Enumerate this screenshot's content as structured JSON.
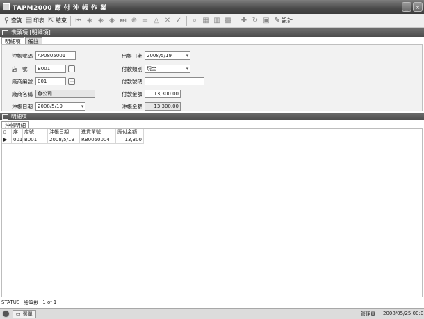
{
  "window": {
    "title": "TAPM2000 應 付 沖 帳 作 業",
    "controls": [
      "minimize",
      "close"
    ]
  },
  "toolbar": {
    "query_label": "查詢",
    "print_label": "印表",
    "exit_label": "結束",
    "design_label": "設計"
  },
  "header": {
    "title": "表頭項 [明細項]"
  },
  "form_tabs": [
    "明細項",
    "備註"
  ],
  "form": {
    "voucher_no_label": "沖帳號碼",
    "voucher_no": "AP0805001",
    "store_label": "店　號",
    "store": "B001",
    "vendor_code_label": "廠商編號",
    "vendor_code": "001",
    "vendor_name_label": "廠商名稱",
    "vendor_name": "魚公司",
    "date_label": "沖帳日期",
    "date": "2008/5/19",
    "pay_date_label": "出帳日期",
    "pay_date": "2008/5/19",
    "pay_type_label": "付款類別",
    "pay_type": "現金",
    "pay_no_label": "付款號碼",
    "pay_no": "",
    "pay_amount_label": "付款金額",
    "pay_amount": "13,300.00",
    "offset_amount_label": "沖帳金額",
    "offset_amount": "13,300.00"
  },
  "detail_section": {
    "title": "明細項"
  },
  "detail_tabs": [
    "沖帳明細"
  ],
  "grid": {
    "columns": [
      "序",
      "店號",
      "沖帳日期",
      "進貨單號",
      "應付金額"
    ],
    "rows": [
      [
        "001",
        "B001",
        "2008/5/19",
        "RB0050004",
        "13,300"
      ]
    ]
  },
  "status": {
    "label": "STATUS",
    "records_label": "總筆數",
    "records": "1 of 1"
  },
  "taskbar": {
    "task_label": "選單",
    "user": "管理員",
    "datetime": "2008/05/25 00:0"
  }
}
